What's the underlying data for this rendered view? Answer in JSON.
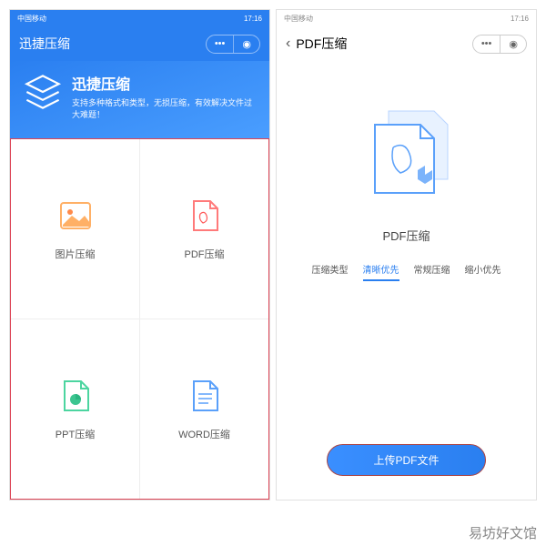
{
  "status": {
    "carrier": "中国移动",
    "signal": "📶",
    "time": "17:16",
    "battery": "🔋"
  },
  "left": {
    "title": "迅捷压缩",
    "hero_title": "迅捷压缩",
    "hero_sub": "支持多种格式和类型，无损压缩，有效解决文件过大难题！",
    "cells": [
      "图片压缩",
      "PDF压缩",
      "PPT压缩",
      "WORD压缩"
    ]
  },
  "right": {
    "title": "PDF压缩",
    "illustration_title": "PDF压缩",
    "tabs": [
      "压缩类型",
      "清晰优先",
      "常规压缩",
      "缩小优先"
    ],
    "upload": "上传PDF文件"
  },
  "watermark": "易坊好文馆"
}
